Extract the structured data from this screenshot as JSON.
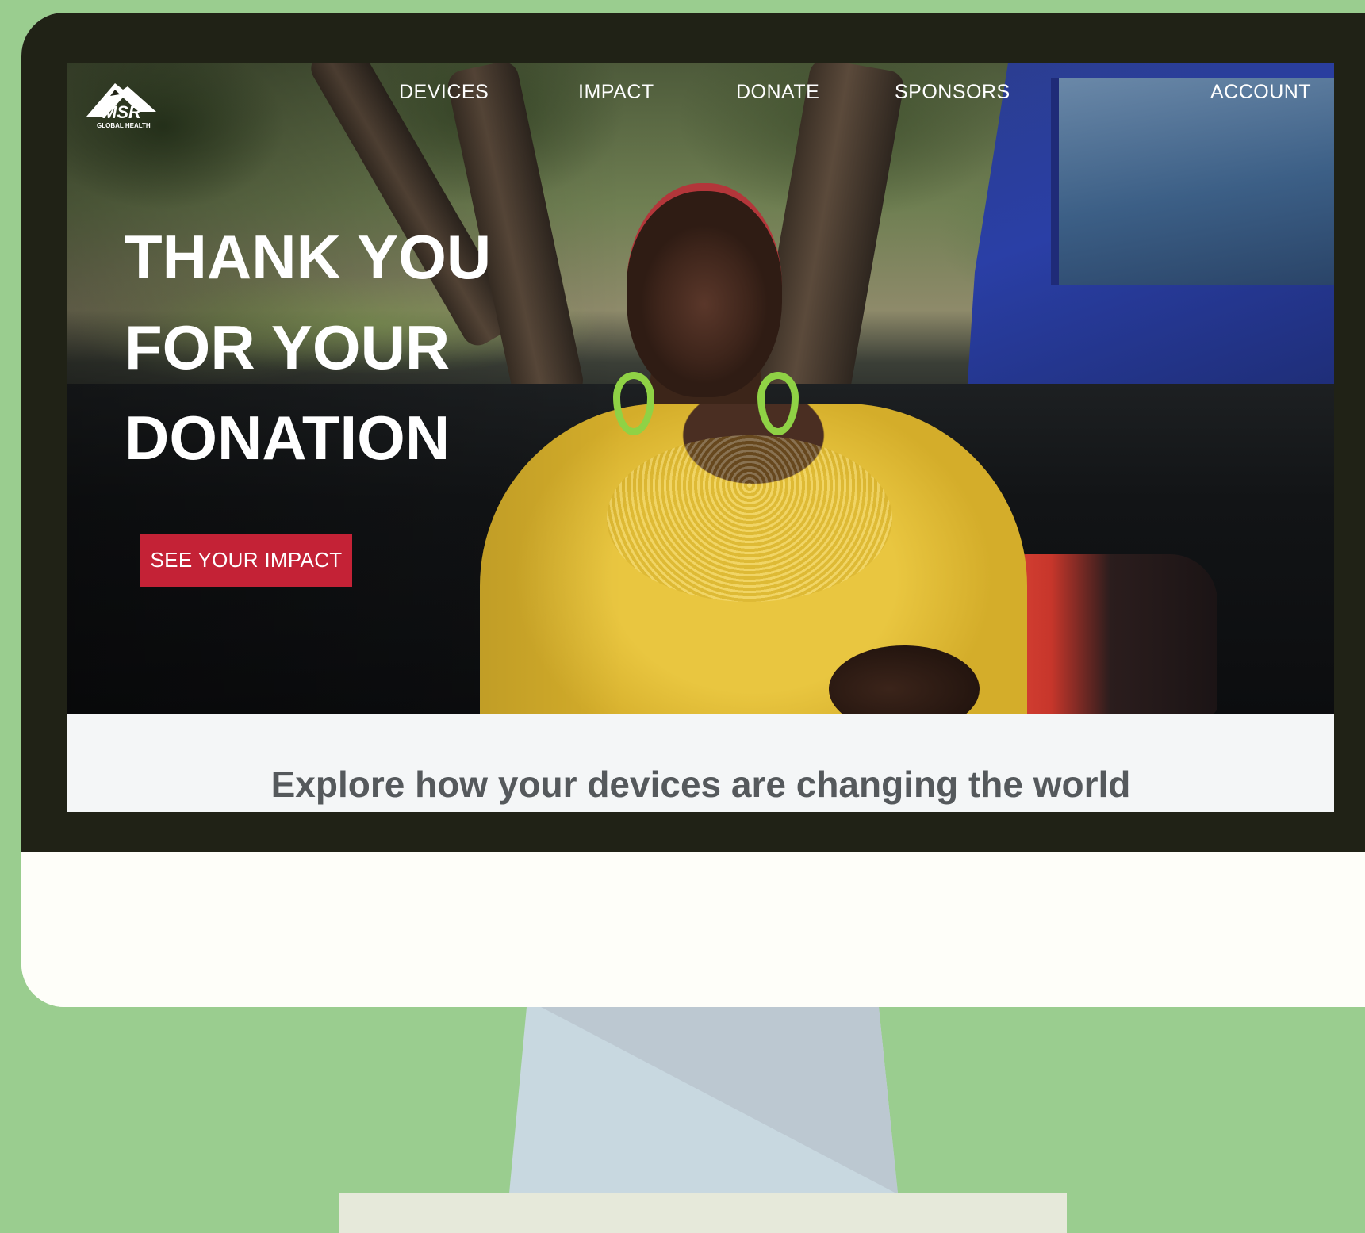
{
  "brand": {
    "logo_text": "MSR",
    "logo_subtext": "GLOBAL HEALTH"
  },
  "nav": {
    "items": [
      {
        "label": "DEVICES"
      },
      {
        "label": "IMPACT"
      },
      {
        "label": "DONATE"
      },
      {
        "label": "SPONSORS"
      },
      {
        "label": "ACCOUNT"
      }
    ]
  },
  "hero": {
    "headline_lines": [
      "THANK YOU",
      "FOR YOUR",
      "DONATION"
    ],
    "cta_label": "SEE YOUR IMPACT"
  },
  "explore": {
    "title": "Explore how your devices are changing the world"
  },
  "colors": {
    "background": "#9acd8f",
    "bezel": "#202216",
    "cta": "#c42236",
    "monitor_chin": "#fefef9",
    "stand": "#c8d8e0"
  },
  "icons": {
    "logo": "msr-mountain-logo-icon"
  }
}
